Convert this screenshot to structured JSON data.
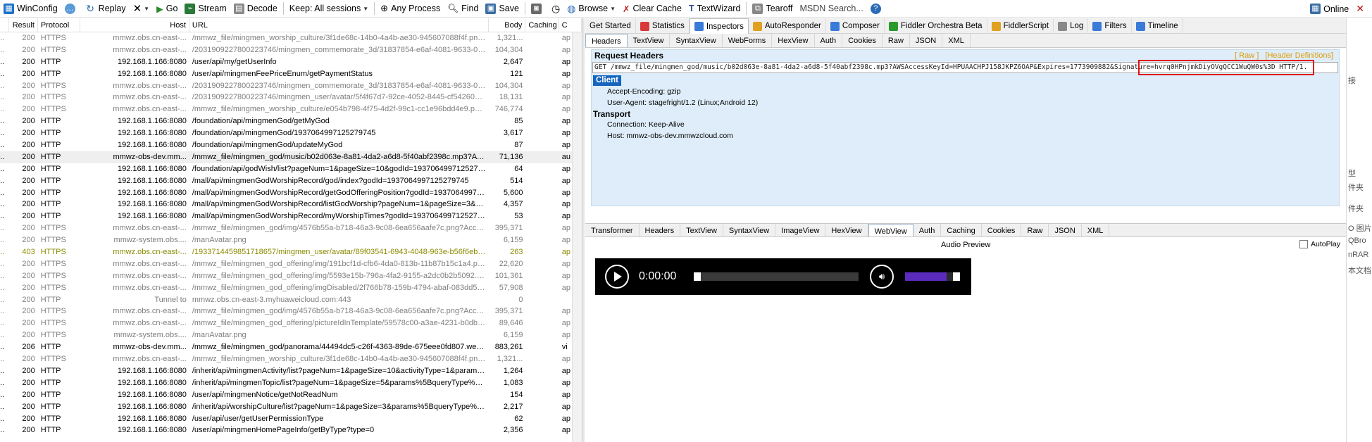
{
  "toolbar": {
    "winconfig": "WinConfig",
    "replay": "Replay",
    "go": "Go",
    "stream": "Stream",
    "decode": "Decode",
    "keep": "Keep: All sessions",
    "process": "Any Process",
    "find": "Find",
    "save": "Save",
    "browse": "Browse",
    "clear_cache": "Clear Cache",
    "textwizard": "TextWizard",
    "tearoff": "Tearoff",
    "msdn": "MSDN Search...",
    "online": "Online"
  },
  "columns": {
    "result": "Result",
    "protocol": "Protocol",
    "host": "Host",
    "url": "URL",
    "body": "Body",
    "caching": "Caching",
    "ct": "C"
  },
  "sessions": [
    {
      "r": "200",
      "p": "HTTPS",
      "h": "mmwz.obs.cn-east-...",
      "u": "/mmwz_file/mingmen_worship_culture/3f1de68c-14b0-4a4b-ae30-945607088f4f.png?A...",
      "b": "1,321...",
      "ct": "ap",
      "s": "gray"
    },
    {
      "r": "200",
      "p": "HTTPS",
      "h": "mmwz.obs.cn-east-...",
      "u": "/2031909227800223746/mingmen_commemorate_3d/31837854-e6af-4081-9633-0296...",
      "b": "104,304",
      "ct": "ap",
      "s": "gray"
    },
    {
      "r": "200",
      "p": "HTTP",
      "h": "192.168.1.166:8080",
      "u": "/user/api/my/getUserInfo",
      "b": "2,647",
      "ct": "ap",
      "s": "normal"
    },
    {
      "r": "200",
      "p": "HTTP",
      "h": "192.168.1.166:8080",
      "u": "/user/api/mingmenFeePriceEnum/getPaymentStatus",
      "b": "121",
      "ct": "ap",
      "s": "normal"
    },
    {
      "r": "200",
      "p": "HTTPS",
      "h": "mmwz.obs.cn-east-...",
      "u": "/2031909227800223746/mingmen_commemorate_3d/31837854-e6af-4081-9633-0296...",
      "b": "104,304",
      "ct": "ap",
      "s": "gray"
    },
    {
      "r": "200",
      "p": "HTTPS",
      "h": "mmwz.obs.cn-east-...",
      "u": "/2031909227800223746/mingmen_user/avatar/5f4f67d7-92ce-4052-8445-cf54260060...",
      "b": "18,131",
      "ct": "ap",
      "s": "gray"
    },
    {
      "r": "200",
      "p": "HTTPS",
      "h": "mmwz.obs.cn-east-...",
      "u": "/mmwz_file/mingmen_worship_culture/e054b798-4f75-4d2f-99c1-cc1e96bdd4e9.png...",
      "b": "746,774",
      "ct": "ap",
      "s": "gray"
    },
    {
      "r": "200",
      "p": "HTTP",
      "h": "192.168.1.166:8080",
      "u": "/foundation/api/mingmenGod/getMyGod",
      "b": "85",
      "ct": "ap",
      "s": "normal"
    },
    {
      "r": "200",
      "p": "HTTP",
      "h": "192.168.1.166:8080",
      "u": "/foundation/api/mingmenGod/1937064997125279745",
      "b": "3,617",
      "ct": "ap",
      "s": "normal"
    },
    {
      "r": "200",
      "p": "HTTP",
      "h": "192.168.1.166:8080",
      "u": "/foundation/api/mingmenGod/updateMyGod",
      "b": "87",
      "ct": "ap",
      "s": "normal"
    },
    {
      "r": "200",
      "p": "HTTP",
      "h": "mmwz-obs-dev.mm...",
      "u": "/mmwz_file/mingmen_god/music/b02d063e-8a81-4da2-a6d8-5f40abf2398c.mp3?AWSA...",
      "b": "71,136",
      "ct": "au",
      "s": "sel"
    },
    {
      "r": "200",
      "p": "HTTP",
      "h": "192.168.1.166:8080",
      "u": "/foundation/api/godWish/list?pageNum=1&pageSize=10&godId=1937064997125279745",
      "b": "64",
      "ct": "ap",
      "s": "normal"
    },
    {
      "r": "200",
      "p": "HTTP",
      "h": "192.168.1.166:8080",
      "u": "/mall/api/mingmenGodWorshipRecord/god/index?godId=1937064997125279745",
      "b": "514",
      "ct": "ap",
      "s": "normal"
    },
    {
      "r": "200",
      "p": "HTTP",
      "h": "192.168.1.166:8080",
      "u": "/mall/api/mingmenGodWorshipRecord/getGodOfferingPosition?godId=1937064997125279745",
      "b": "5,600",
      "ct": "ap",
      "s": "normal"
    },
    {
      "r": "200",
      "p": "HTTP",
      "h": "192.168.1.166:8080",
      "u": "/mall/api/mingmenGodWorshipRecord/listGodWorship?pageNum=1&pageSize=3&godId...",
      "b": "4,357",
      "ct": "ap",
      "s": "normal"
    },
    {
      "r": "200",
      "p": "HTTP",
      "h": "192.168.1.166:8080",
      "u": "/mall/api/mingmenGodWorshipRecord/myWorshipTimes?godId=1937064997125279745",
      "b": "53",
      "ct": "ap",
      "s": "normal"
    },
    {
      "r": "200",
      "p": "HTTPS",
      "h": "mmwz.obs.cn-east-...",
      "u": "/mmwz_file/mingmen_god/img/4576b55a-b718-46a3-9c08-6ea656aafe7c.png?AccessK...",
      "b": "395,371",
      "ct": "ap",
      "s": "gray"
    },
    {
      "r": "200",
      "p": "HTTPS",
      "h": "mmwz-system.obs....",
      "u": "/manAvatar.png",
      "b": "6,159",
      "ct": "ap",
      "s": "gray"
    },
    {
      "r": "403",
      "p": "HTTPS",
      "h": "mmwz.obs.cn-east-...",
      "u": "/1933714459851718657/mingmen_user/avatar/89f03541-6943-4048-963e-b56f6eb20c...",
      "b": "263",
      "ct": "ap",
      "s": "olive"
    },
    {
      "r": "200",
      "p": "HTTPS",
      "h": "mmwz.obs.cn-east-...",
      "u": "/mmwz_file/mingmen_god_offering/img/191bcf1d-cfb6-4da0-813b-11b87b15c1a4.png?...",
      "b": "22,620",
      "ct": "ap",
      "s": "gray"
    },
    {
      "r": "200",
      "p": "HTTPS",
      "h": "mmwz.obs.cn-east-...",
      "u": "/mmwz_file/mingmen_god_offering/img/5593e15b-796a-4fa2-9155-a2dc0b2b5092.png...",
      "b": "101,361",
      "ct": "ap",
      "s": "gray"
    },
    {
      "r": "200",
      "p": "HTTPS",
      "h": "mmwz.obs.cn-east-...",
      "u": "/mmwz_file/mingmen_god_offering/imgDisabled/2f766b78-159b-4794-abaf-083dd5f939...",
      "b": "57,908",
      "ct": "ap",
      "s": "gray"
    },
    {
      "r": "200",
      "p": "HTTP",
      "h": "Tunnel to",
      "u": "mmwz.obs.cn-east-3.myhuaweicloud.com:443",
      "b": "0",
      "ct": "",
      "s": "gray"
    },
    {
      "r": "200",
      "p": "HTTPS",
      "h": "mmwz.obs.cn-east-...",
      "u": "/mmwz_file/mingmen_god/img/4576b55a-b718-46a3-9c08-6ea656aafe7c.png?AccessK...",
      "b": "395,371",
      "ct": "ap",
      "s": "gray"
    },
    {
      "r": "200",
      "p": "HTTPS",
      "h": "mmwz.obs.cn-east-...",
      "u": "/mmwz_file/mingmen_god_offering/pictureIdInTemplate/59578c00-a3ae-4231-b0db-1c...",
      "b": "89,646",
      "ct": "ap",
      "s": "gray"
    },
    {
      "r": "200",
      "p": "HTTPS",
      "h": "mmwz-system.obs....",
      "u": "/manAvatar.png",
      "b": "6,159",
      "ct": "ap",
      "s": "gray"
    },
    {
      "r": "206",
      "p": "HTTP",
      "h": "mmwz-obs-dev.mm...",
      "u": "/mmwz_file/mingmen_god/panorama/44494dc5-c26f-4363-89de-675eee0fd807.webm?...",
      "b": "883,261",
      "ct": "vi",
      "s": "normal"
    },
    {
      "r": "200",
      "p": "HTTPS",
      "h": "mmwz.obs.cn-east-...",
      "u": "/mmwz_file/mingmen_worship_culture/3f1de68c-14b0-4a4b-ae30-945607088f4f.png?A...",
      "b": "1,321...",
      "ct": "ap",
      "s": "gray"
    },
    {
      "r": "200",
      "p": "HTTP",
      "h": "192.168.1.166:8080",
      "u": "/inherit/api/mingmenActivity/list?pageNum=1&pageSize=10&activityType=1&params%...",
      "b": "1,264",
      "ct": "ap",
      "s": "normal"
    },
    {
      "r": "200",
      "p": "HTTP",
      "h": "192.168.1.166:8080",
      "u": "/inherit/api/mingmenTopic/list?pageNum=1&pageSize=5&params%5BqueryType%5D=k...",
      "b": "1,083",
      "ct": "ap",
      "s": "normal"
    },
    {
      "r": "200",
      "p": "HTTP",
      "h": "192.168.1.166:8080",
      "u": "/user/api/mingmenNotice/getNotReadNum",
      "b": "154",
      "ct": "ap",
      "s": "normal"
    },
    {
      "r": "200",
      "p": "HTTP",
      "h": "192.168.1.166:8080",
      "u": "/inherit/api/worshipCulture/list?pageNum=1&pageSize=3&params%5BqueryType%5D=...",
      "b": "2,217",
      "ct": "ap",
      "s": "normal"
    },
    {
      "r": "200",
      "p": "HTTP",
      "h": "192.168.1.166:8080",
      "u": "/user/api/user/getUserPermissionType",
      "b": "62",
      "ct": "ap",
      "s": "normal"
    },
    {
      "r": "200",
      "p": "HTTP",
      "h": "192.168.1.166:8080",
      "u": "/user/api/mingmenHomePageInfo/getByType?type=0",
      "b": "2,356",
      "ct": "ap",
      "s": "normal"
    }
  ],
  "top_tabs": [
    "Get Started",
    "Statistics",
    "Inspectors",
    "AutoResponder",
    "Composer",
    "Fiddler Orchestra Beta",
    "FiddlerScript",
    "Log",
    "Filters",
    "Timeline"
  ],
  "req_tabs": [
    "Headers",
    "TextView",
    "SyntaxView",
    "WebForms",
    "HexView",
    "Auth",
    "Cookies",
    "Raw",
    "JSON",
    "XML"
  ],
  "request": {
    "title": "Request Headers",
    "raw_link": "[ Raw ]",
    "defs_link": "[Header Definitions]",
    "line": "GET /mmwz_file/mingmen_god/music/b02d063e-8a81-4da2-a6d8-5f40abf2398c.mp3?AWSAccessKeyId=HPUAACHPJ158JKPZ6OAP&Expires=1773909882&Signature=hvrq0HPnjmkDiyOVgQCC1WuQW0s%3D HTTP/1.",
    "client_label": "Client",
    "client_headers": [
      "Accept-Encoding: gzip",
      "User-Agent: stagefright/1.2 (Linux;Android 12)"
    ],
    "transport_label": "Transport",
    "transport_headers": [
      "Connection: Keep-Alive",
      "Host: mmwz-obs-dev.mmwzcloud.com"
    ]
  },
  "resp_tabs": [
    "Transformer",
    "Headers",
    "TextView",
    "SyntaxView",
    "ImageView",
    "HexView",
    "WebView",
    "Auth",
    "Caching",
    "Cookies",
    "Raw",
    "JSON",
    "XML"
  ],
  "audio": {
    "title": "Audio Preview",
    "autoplay": "AutoPlay",
    "time": "0:00:00",
    "volume_level": 0.75
  },
  "edge_labels": [
    "接",
    "型",
    "件夹",
    "件夹",
    "O 图片",
    "QBro",
    "nRAR",
    "本文档"
  ]
}
